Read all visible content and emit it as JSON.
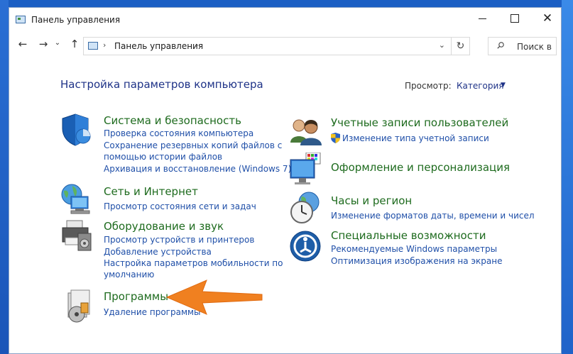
{
  "window": {
    "title": "Панель управления"
  },
  "address": {
    "path": "Панель управления",
    "search_placeholder": "Поиск в"
  },
  "main": {
    "heading": "Настройка параметров компьютера",
    "view_label": "Просмотр:",
    "view_value": "Категория"
  },
  "categories": [
    {
      "title": "Система и безопасность",
      "links": [
        "Проверка состояния компьютера",
        "Сохранение резервных копий файлов с",
        "помощью истории файлов",
        "Архивация и восстановление (Windows 7)"
      ]
    },
    {
      "title": "Сеть и Интернет",
      "links": [
        "Просмотр состояния сети и задач"
      ]
    },
    {
      "title": "Оборудование и звук",
      "links": [
        "Просмотр устройств и принтеров",
        "Добавление устройства",
        "Настройка параметров мобильности по",
        "умолчанию"
      ]
    },
    {
      "title": "Программы",
      "links": [
        "Удаление программы"
      ]
    },
    {
      "title": "Учетные записи пользователей",
      "links": [
        "Изменение типа учетной записи"
      ]
    },
    {
      "title": "Оформление и персонализация",
      "links": []
    },
    {
      "title": "Часы и регион",
      "links": [
        "Изменение форматов даты, времени и чисел"
      ]
    },
    {
      "title": "Специальные возможности",
      "links": [
        "Рекомендуемые Windows параметры",
        "Оптимизация изображения на экране"
      ]
    }
  ],
  "colors": {
    "heading": "#1e3287",
    "category_title": "#1e6b1e",
    "link": "#1f4fa8",
    "annotation_arrow": "#f08020"
  }
}
